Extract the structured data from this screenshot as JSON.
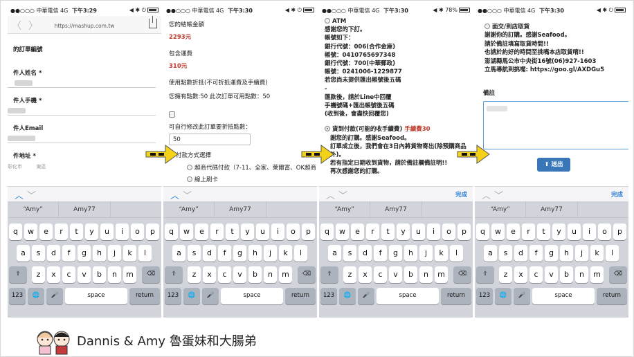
{
  "status": {
    "p1": {
      "carrier": "●●○○○ 中華電信 4G",
      "time": "下午3:29",
      "right": "◀ ✱ ⏻"
    },
    "p2": {
      "carrier": "●●○○○ 中華電信 4G",
      "time": "下午3:30",
      "right": "◀ ✱ ⏻"
    },
    "p3": {
      "carrier": "●●○○○ 中華電信 4G",
      "time": "下午3:30",
      "right": "◀ ✱ 78%"
    },
    "p4": {
      "carrier": "●●○○○ 中華電信 4G",
      "time": "下午3:30",
      "right": "◀ ✱ ⏻"
    }
  },
  "browser": {
    "url": "https://mashup.com.tw",
    "back": "〈",
    "forward": "〉"
  },
  "panel1": {
    "order_no": "的訂單編號",
    "name": "件人姓名 *",
    "phone": "件人手機 *",
    "email": "件人Email",
    "address": "件地址 *",
    "city": "彰化市",
    "district": "東區"
  },
  "panel2": {
    "total_label": "您的結帳金額",
    "total": "2293元",
    "shipping_label": "包含運費",
    "shipping": "310元",
    "points_label": "使用點數折抵(不可折抵運費及手續費)",
    "points_info": "您擁有點數:50 此次訂單可用點數：50",
    "custom_label": "可自行修改此訂單要折抵點數：",
    "points_value": "50",
    "pay_label": "付款方式選擇",
    "pay_opt1": "超商代碼付款（7-11、全家、萊爾富、OK超商",
    "pay_opt2": "線上刷卡"
  },
  "panel3": {
    "atm": "ATM",
    "l1": "感謝您的下訂。",
    "l2": "帳號如下：",
    "l3": "銀行代號：006(合作金庫)",
    "l4": "帳號：0410765697348",
    "l5": "銀行代號：700(中華郵政)",
    "l6": "帳號：0241006-1229877",
    "l7": "若您尚未提供匯出帳號後五碼",
    "l8": "-",
    "l9": "匯款後，請於Line中回覆",
    "l10": "手機號碼+匯出帳號後五碼",
    "l11": "(收到後，會盡快回覆您)",
    "cod": "貨到付款(可能的收手續費)",
    "cod_fee": "手續費30",
    "l12": "謝您的訂購。感謝Seafood。",
    "l13": "訂單成立後，我們會在3日內將貨物寄出(除預購商品",
    "l14": "外)。",
    "l15": "若有指定日期收到貨物，請於備註欄備註明!!",
    "l16": "再次感謝您的訂購。"
  },
  "panel4": {
    "pickup": "面交/到店取貨",
    "l1": "謝謝你的訂購。感謝Seafood。",
    "l2": "請於備註填寫取貨時間!!",
    "l3": "也請於約好的時間至挑嘴本店取貨唷!!",
    "l4": "澎湖縣馬公市中央街16號(06)927-1603",
    "l5": "立馬導航到挑嘴: https://goo.gl/AXDGu5",
    "remark_label": "備註",
    "submit": "送出"
  },
  "keyboard": {
    "suggestions": [
      "“Amy”",
      "Amy77",
      ""
    ],
    "row1": [
      "q",
      "w",
      "e",
      "r",
      "t",
      "y",
      "u",
      "i",
      "o",
      "p"
    ],
    "row2": [
      "a",
      "s",
      "d",
      "f",
      "g",
      "h",
      "j",
      "k",
      "l"
    ],
    "row3": [
      "z",
      "x",
      "c",
      "v",
      "b",
      "n",
      "m"
    ],
    "num": "123",
    "space": "space",
    "ret": "return",
    "done": "完成"
  },
  "footer": {
    "credit": "Dannis & Amy 魯蛋妹和大腸弟"
  },
  "colors": {
    "arrow": "#f4d21a",
    "price": "#c0392b",
    "submit": "#3a77b8",
    "link": "#2b7cd3"
  }
}
